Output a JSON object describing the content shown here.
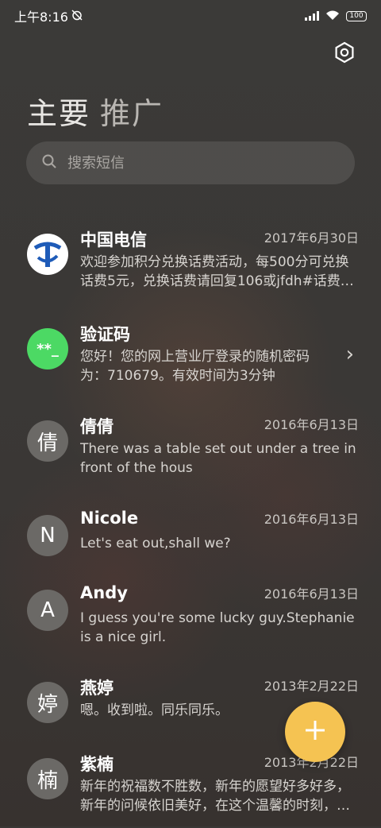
{
  "status": {
    "time": "上午8:16",
    "battery": "100"
  },
  "tabs": {
    "main": "主要",
    "promo": "推广"
  },
  "search": {
    "placeholder": "搜索短信"
  },
  "messages": [
    {
      "sender": "中国电信",
      "date": "2017年6月30日",
      "preview": "欢迎参加积分兑换话费活动，每500分可兑换话费5元，兑换话费请回复106或jfdh#话费…",
      "avatar": "china-telecom-logo"
    },
    {
      "sender": "验证码",
      "date": "",
      "preview": "您好！您的网上营业厅登录的随机密码为：710679。有效时间为3分钟",
      "avatar_text": "**_"
    },
    {
      "sender": "倩倩",
      "date": "2016年6月13日",
      "preview": "There was a table set out under a tree in front of the hous",
      "avatar_text": "倩"
    },
    {
      "sender": "Nicole",
      "date": "2016年6月13日",
      "preview": "Let's eat out,shall we?",
      "avatar_text": "N"
    },
    {
      "sender": "Andy",
      "date": "2016年6月13日",
      "preview": "I guess you're some lucky guy.Stephanie is a nice girl.",
      "avatar_text": "A"
    },
    {
      "sender": "燕婷",
      "date": "2013年2月22日",
      "preview": "嗯。收到啦。同乐同乐。",
      "avatar_text": "婷"
    },
    {
      "sender": "紫楠",
      "date": "2013年2月22日",
      "preview": "新年的祝福数不胜数，新年的愿望好多好多，新年的问候依旧美好，在这个温馨的时刻，…",
      "avatar_text": "楠"
    }
  ],
  "colors": {
    "background": "#3a3836",
    "verify_green": "#4cd964",
    "telecom_blue": "#1e5bb8",
    "fab_yellow": "#f5c352"
  }
}
